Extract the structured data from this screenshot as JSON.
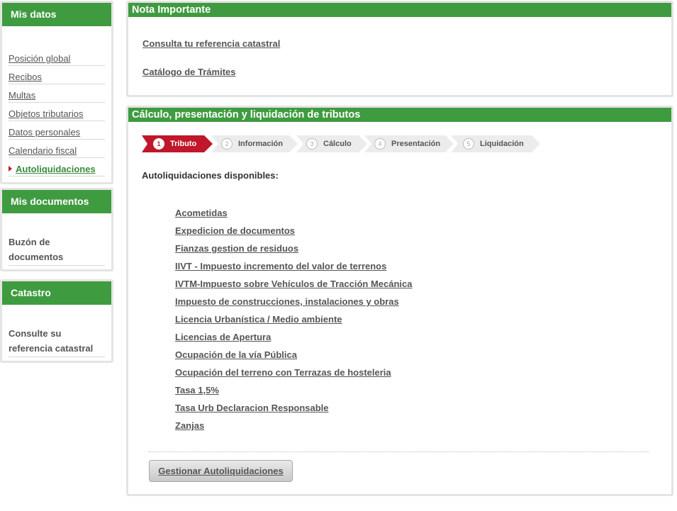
{
  "sidebar": {
    "mis_datos": {
      "title": "Mis datos",
      "items": [
        {
          "label": "Posición global"
        },
        {
          "label": "Recibos"
        },
        {
          "label": "Multas"
        },
        {
          "label": "Objetos tributarios"
        },
        {
          "label": "Datos personales"
        },
        {
          "label": "Calendario fiscal"
        },
        {
          "label": "Autoliquidaciones",
          "active": true
        }
      ]
    },
    "mis_documentos": {
      "title": "Mis documentos",
      "link_line1": "Buzón de",
      "link_line2": "documentos"
    },
    "catastro": {
      "title": "Catastro",
      "link_line1": "Consulte su",
      "link_line2": "referencia catastral"
    }
  },
  "nota": {
    "title": "Nota Importante",
    "links": [
      "Consulta tu referencia catastral",
      "Catálogo de Trámites"
    ]
  },
  "calculo": {
    "title": "Cálculo, presentación y liquidación de tributos",
    "steps": [
      {
        "num": "1",
        "label": "Tributo",
        "active": true
      },
      {
        "num": "2",
        "label": "Información"
      },
      {
        "num": "3",
        "label": "Cálculo"
      },
      {
        "num": "4",
        "label": "Presentación"
      },
      {
        "num": "5",
        "label": "Liquidación"
      }
    ],
    "available_title": "Autoliquidaciones disponibles:",
    "tributos": [
      "Acometidas",
      "Expedicion de documentos",
      "Fianzas gestion de residuos",
      "IIVT - Impuesto incremento del valor de terrenos",
      "IVTM-Impuesto sobre Vehículos de Tracción Mecánica",
      "Impuesto de construcciones, instalaciones y obras",
      "Licencia Urbanística / Medio ambiente",
      "Licencias de Apertura",
      "Ocupación de la vía Pública",
      "Ocupación del terreno con Terrazas de hosteleria",
      "Tasa 1,5%",
      "Tasa Urb Declaracion Responsable",
      "Zanjas"
    ],
    "button_label": "Gestionar Autoliquidaciones"
  },
  "colors": {
    "header_green": "#3f9b40",
    "active_red": "#c0172a",
    "step_gray": "#ececec"
  }
}
